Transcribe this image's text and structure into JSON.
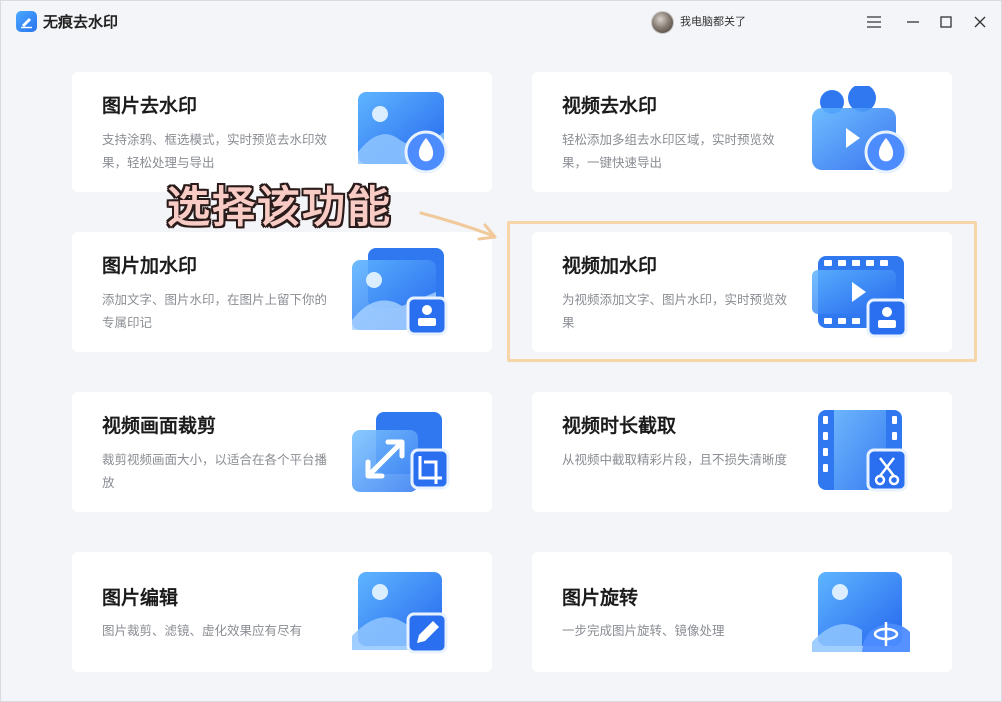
{
  "app": {
    "title": "无痕去水印",
    "user_name": "我电脑都关了"
  },
  "annotation": {
    "text": "选择该功能"
  },
  "cards": [
    {
      "title": "图片去水印",
      "desc": "支持涂鸦、框选模式，实时预览去水印效果，轻松处理与导出",
      "icon": "image-remove-watermark-icon"
    },
    {
      "title": "视频去水印",
      "desc": "轻松添加多组去水印区域，实时预览效果，一键快速导出",
      "icon": "video-remove-watermark-icon"
    },
    {
      "title": "图片加水印",
      "desc": "添加文字、图片水印，在图片上留下你的专属印记",
      "icon": "image-add-watermark-icon"
    },
    {
      "title": "视频加水印",
      "desc": "为视频添加文字、图片水印，实时预览效果",
      "icon": "video-add-watermark-icon"
    },
    {
      "title": "视频画面裁剪",
      "desc": "裁剪视频画面大小，以适合在各个平台播放",
      "icon": "video-crop-icon"
    },
    {
      "title": "视频时长截取",
      "desc": "从视频中截取精彩片段，且不损失清晰度",
      "icon": "video-trim-icon"
    },
    {
      "title": "图片编辑",
      "desc": "图片裁剪、滤镜、虚化效果应有尽有",
      "icon": "image-edit-icon"
    },
    {
      "title": "图片旋转",
      "desc": "一步完成图片旋转、镜像处理",
      "icon": "image-rotate-icon"
    }
  ],
  "colors": {
    "accent": "#2a73f0",
    "highlight_border": "#f6d5a8",
    "annotation_fill": "#f8ccc4"
  }
}
